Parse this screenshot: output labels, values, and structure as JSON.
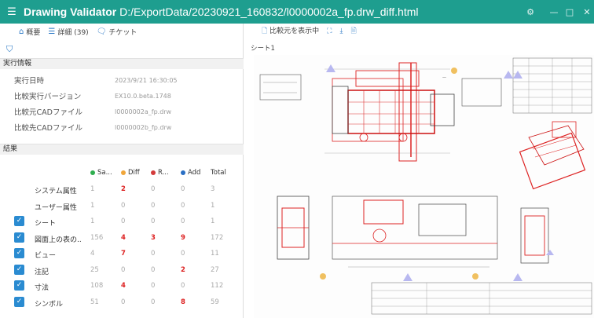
{
  "app": {
    "title": "Drawing Validator",
    "path": "D:/ExportData/20230921_160832/l0000002a_fp.drw_diff.html",
    "menu_icon": "hamburger-icon"
  },
  "window_controls": [
    "settings-icon",
    "minimize-icon",
    "maximize-icon",
    "close-icon"
  ],
  "left_tabs": [
    {
      "label": "概要",
      "icon": "home-icon"
    },
    {
      "label": "詳細 (39)",
      "icon": "list-icon"
    },
    {
      "label": "チケット",
      "icon": "chat-icon"
    }
  ],
  "sections": {
    "exec": "実行情報",
    "result": "結果"
  },
  "info": [
    {
      "key": "実行日時",
      "value": "2023/9/21 16:30:05"
    },
    {
      "key": "比較実行バージョン",
      "value": "EX10.0.beta.1748"
    },
    {
      "key": "比較元CADファイル",
      "value": "l0000002a_fp.drw"
    },
    {
      "key": "比較先CADファイル",
      "value": "l0000002b_fp.drw"
    }
  ],
  "result_headers": {
    "same": "Sa...",
    "diff": "Diff",
    "removed": "R...",
    "add": "Add",
    "total": "Total"
  },
  "colors": {
    "same": "#2fae4f",
    "diff": "#f0a63a",
    "removed": "#d33b3b",
    "add": "#2a6fc4",
    "accent": "#1e9e8f"
  },
  "results": [
    {
      "name": "システム属性",
      "checked": false,
      "same": "1",
      "diff": "2",
      "removed": "0",
      "add": "0",
      "total": "3"
    },
    {
      "name": "ユーザー属性",
      "checked": false,
      "same": "1",
      "diff": "0",
      "removed": "0",
      "add": "0",
      "total": "1"
    },
    {
      "name": "シート",
      "checked": true,
      "same": "1",
      "diff": "0",
      "removed": "0",
      "add": "0",
      "total": "1"
    },
    {
      "name": "図面上の表の...",
      "checked": true,
      "same": "156",
      "diff": "4",
      "removed": "3",
      "add": "9",
      "total": "172"
    },
    {
      "name": "ビュー",
      "checked": true,
      "same": "4",
      "diff": "7",
      "removed": "0",
      "add": "0",
      "total": "11"
    },
    {
      "name": "注記",
      "checked": true,
      "same": "25",
      "diff": "0",
      "removed": "0",
      "add": "2",
      "total": "27"
    },
    {
      "name": "寸法",
      "checked": true,
      "same": "108",
      "diff": "4",
      "removed": "0",
      "add": "0",
      "total": "112"
    },
    {
      "name": "シンボル",
      "checked": true,
      "same": "51",
      "diff": "0",
      "removed": "0",
      "add": "8",
      "total": "59"
    }
  ],
  "right_toolbar": {
    "show_source": "比較元を表示中"
  },
  "sheet_tab": "シート1"
}
